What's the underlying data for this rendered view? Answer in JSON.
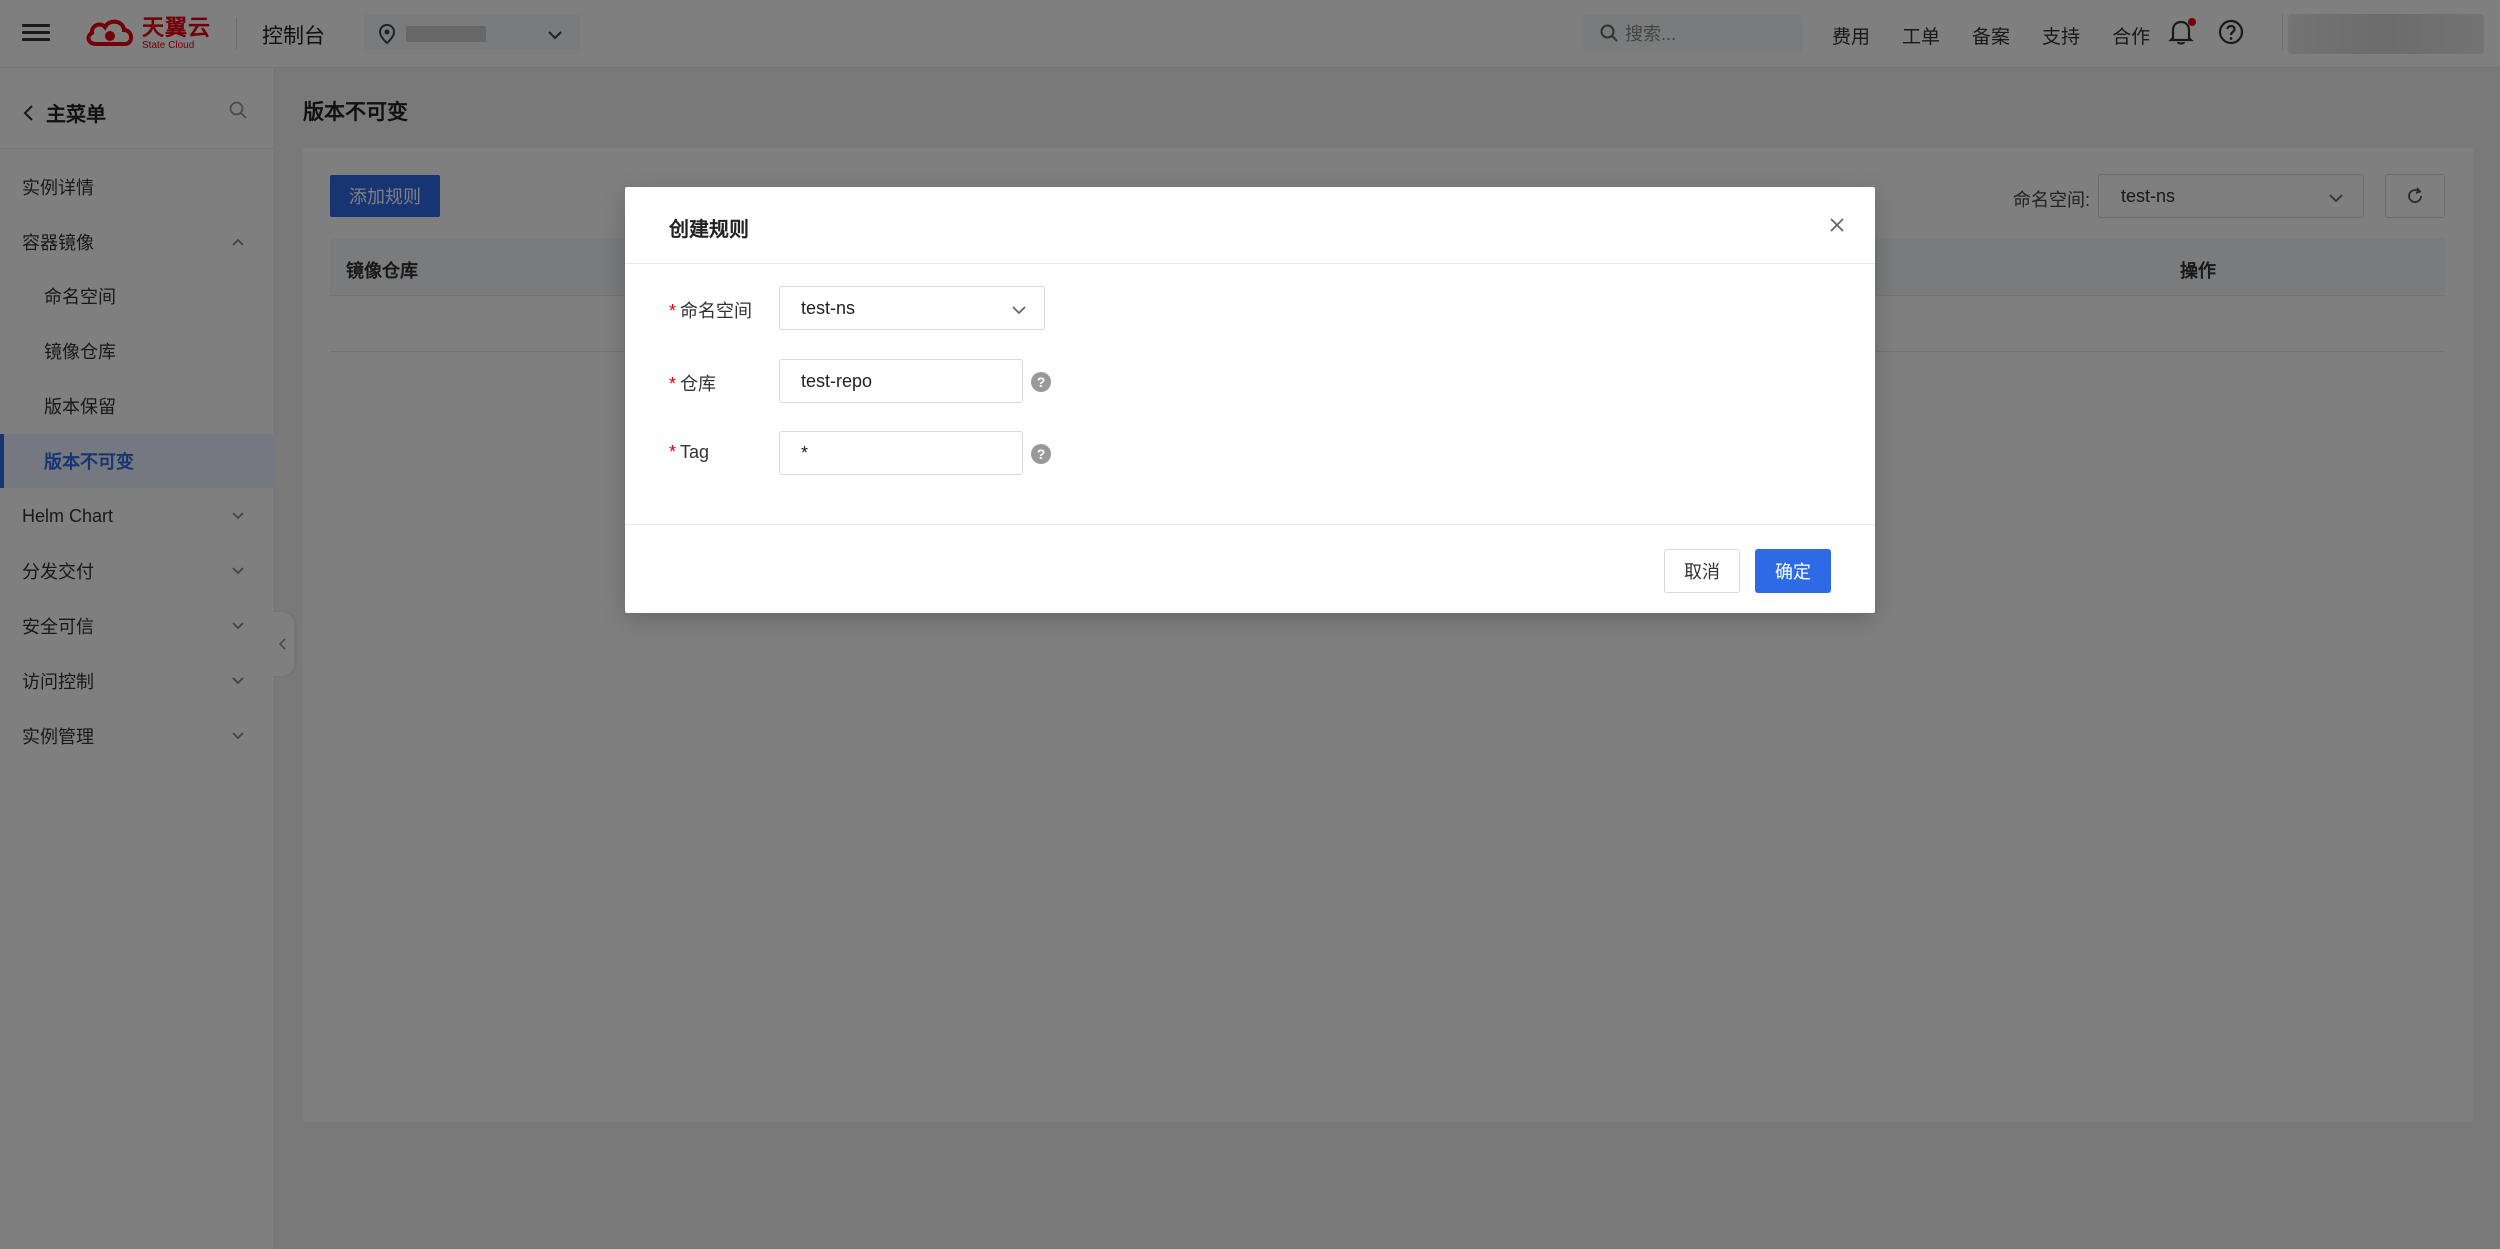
{
  "topbar": {
    "logo_cn": "天翼云",
    "logo_en": "State Cloud",
    "console_title": "控制台",
    "search_placeholder": "搜索...",
    "links": [
      "费用",
      "工单",
      "备案",
      "支持",
      "合作"
    ],
    "brand_color": "#e60012"
  },
  "sidebar": {
    "header": "主菜单",
    "items": [
      {
        "label": "实例详情",
        "type": "item"
      },
      {
        "label": "容器镜像",
        "type": "group",
        "expanded": true
      },
      {
        "label": "命名空间",
        "type": "sub"
      },
      {
        "label": "镜像仓库",
        "type": "sub"
      },
      {
        "label": "版本保留",
        "type": "sub"
      },
      {
        "label": "版本不可变",
        "type": "sub",
        "active": true
      },
      {
        "label": "Helm Chart",
        "type": "group",
        "expanded": false
      },
      {
        "label": "分发交付",
        "type": "group",
        "expanded": false
      },
      {
        "label": "安全可信",
        "type": "group",
        "expanded": false
      },
      {
        "label": "访问控制",
        "type": "group",
        "expanded": false
      },
      {
        "label": "实例管理",
        "type": "group",
        "expanded": false
      }
    ]
  },
  "main": {
    "page_title": "版本不可变",
    "add_button": "添加规则",
    "ns_label": "命名空间:",
    "ns_value": "test-ns",
    "table_headers": [
      "镜像仓库",
      "操作"
    ],
    "accent_color": "#2e6ae6"
  },
  "modal": {
    "title": "创建规则",
    "fields": [
      {
        "label": "命名空间",
        "value": "test-ns",
        "type": "select"
      },
      {
        "label": "仓库",
        "value": "test-repo",
        "type": "input"
      },
      {
        "label": "Tag",
        "value": "*",
        "type": "input"
      }
    ],
    "cancel": "取消",
    "confirm": "确定"
  }
}
